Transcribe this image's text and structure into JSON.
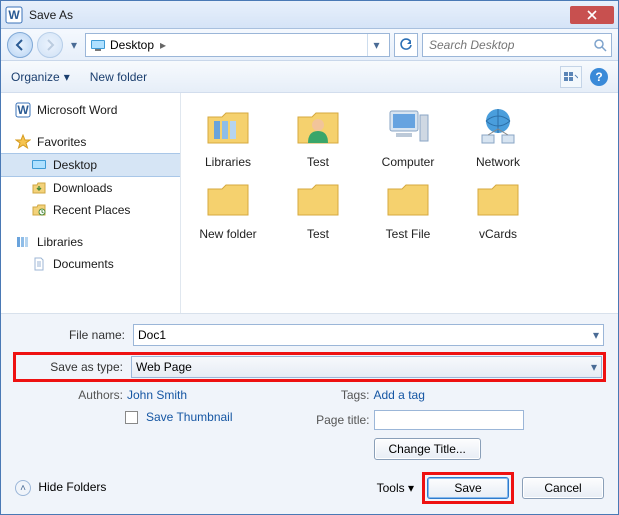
{
  "title": "Save As",
  "breadcrumb": {
    "location": "Desktop"
  },
  "search": {
    "placeholder": "Search Desktop"
  },
  "toolbar": {
    "organize": "Organize",
    "newfolder": "New folder"
  },
  "sidebar": {
    "word": "Microsoft Word",
    "favorites": "Favorites",
    "desktop": "Desktop",
    "downloads": "Downloads",
    "recent": "Recent Places",
    "libraries": "Libraries",
    "documents": "Documents"
  },
  "items": {
    "i0": "Libraries",
    "i1": "Test",
    "i2": "Computer",
    "i3": "Network",
    "i4": "New folder",
    "i5": "Test",
    "i6": "Test File",
    "i7": "vCards"
  },
  "form": {
    "filename_lbl": "File name:",
    "filename_val": "Doc1",
    "type_lbl": "Save as type:",
    "type_val": "Web Page",
    "authors_lbl": "Authors:",
    "authors_val": "John Smith",
    "tags_lbl": "Tags:",
    "tags_val": "Add a tag",
    "thumb_lbl": "Save Thumbnail",
    "pagetitle_lbl": "Page title:",
    "changetitle_btn": "Change Title...",
    "hidefolders": "Hide Folders",
    "tools": "Tools",
    "save": "Save",
    "cancel": "Cancel"
  }
}
